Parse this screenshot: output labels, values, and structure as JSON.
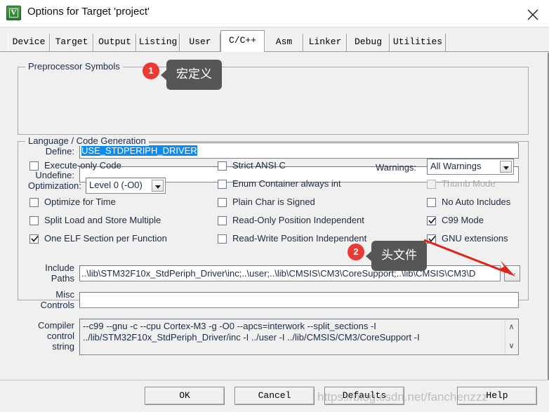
{
  "window": {
    "title": "Options for Target 'project'",
    "icon": "keil-uvision-icon",
    "close_label": "close-icon"
  },
  "tabs": [
    {
      "label": "Device",
      "active": false
    },
    {
      "label": "Target",
      "active": false
    },
    {
      "label": "Output",
      "active": false
    },
    {
      "label": "Listing",
      "active": false
    },
    {
      "label": "User",
      "active": false
    },
    {
      "label": "C/C++",
      "active": true
    },
    {
      "label": "Asm",
      "active": false
    },
    {
      "label": "Linker",
      "active": false
    },
    {
      "label": "Debug",
      "active": false
    },
    {
      "label": "Utilities",
      "active": false
    }
  ],
  "preprocessor": {
    "legend": "Preprocessor Symbols",
    "define_label": "Define:",
    "define_value": "USE_STDPERIPH_DRIVER",
    "undefine_label": "Undefine:",
    "undefine_value": ""
  },
  "language": {
    "legend": "Language / Code Generation",
    "left_checkboxes": [
      {
        "label": "Execute-only Code",
        "checked": false,
        "disabled": false
      },
      {
        "label": "Optimize for Time",
        "checked": false,
        "disabled": false
      },
      {
        "label": "Split Load and Store Multiple",
        "checked": false,
        "disabled": false
      },
      {
        "label": "One ELF Section per Function",
        "checked": true,
        "disabled": false
      }
    ],
    "optimization_label": "Optimization:",
    "optimization_value": "Level 0 (-O0)",
    "middle_checkboxes": [
      {
        "label": "Strict ANSI C",
        "checked": false,
        "disabled": false
      },
      {
        "label": "Enum Container always int",
        "checked": false,
        "disabled": false
      },
      {
        "label": "Plain Char is Signed",
        "checked": false,
        "disabled": false
      },
      {
        "label": "Read-Only Position Independent",
        "checked": false,
        "disabled": false
      },
      {
        "label": "Read-Write Position Independent",
        "checked": false,
        "disabled": false
      }
    ],
    "warnings_label": "Warnings:",
    "warnings_value": "All Warnings",
    "right_checkboxes": [
      {
        "label": "Thumb Mode",
        "checked": false,
        "disabled": true
      },
      {
        "label": "No Auto Includes",
        "checked": false,
        "disabled": false
      },
      {
        "label": "C99 Mode",
        "checked": true,
        "disabled": false
      },
      {
        "label": "GNU extensions",
        "checked": true,
        "disabled": false
      }
    ]
  },
  "paths": {
    "include_label_line1": "Include",
    "include_label_line2": "Paths",
    "include_value": "..\\lib\\STM32F10x_StdPeriph_Driver\\inc;..\\user;..\\lib\\CMSIS\\CM3\\CoreSupport;..\\lib\\CMSIS\\CM3\\D",
    "browse_label": "...",
    "misc_label_line1": "Misc",
    "misc_label_line2": "Controls",
    "misc_value": ""
  },
  "compiler": {
    "label_line1": "Compiler",
    "label_line2": "control",
    "label_line3": "string",
    "value": "--c99 --gnu -c --cpu Cortex-M3 -g -O0 --apcs=interwork --split_sections -I\n../lib/STM32F10x_StdPeriph_Driver/inc -I ../user -I ../lib/CMSIS/CM3/CoreSupport -I",
    "scroll_up": "∧",
    "scroll_down": "∨"
  },
  "buttons": {
    "ok": "OK",
    "cancel": "Cancel",
    "defaults": "Defaults",
    "help": "Help"
  },
  "annotations": [
    {
      "badge": "1",
      "tip": "宏定义"
    },
    {
      "badge": "2",
      "tip": "头文件"
    }
  ],
  "watermark": "https://blog.csdn.net/fanchenzzz",
  "colors": {
    "badge_red": "#ec3a32",
    "tooltip_gray": "#565656",
    "selection_blue": "#0a8cf0",
    "arrow_red": "#e0241c",
    "dialog_bg": "#f0f0f0"
  }
}
